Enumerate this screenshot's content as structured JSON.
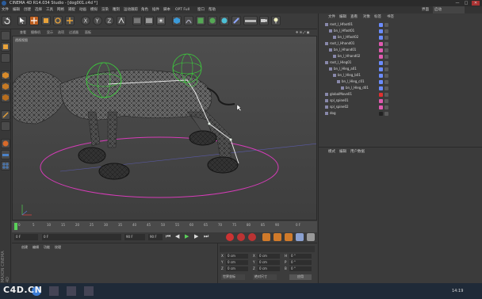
{
  "window": {
    "title": "CINEMA 4D R14.034 Studio - [dog001.c4d *]"
  },
  "window_controls": [
    "—",
    "□",
    "✕"
  ],
  "menus": [
    "文件",
    "编辑",
    "创建",
    "选择",
    "工具",
    "网格",
    "捕捉",
    "动画",
    "模拟",
    "渲染",
    "雕刻",
    "运动跟踪",
    "角色",
    "插件",
    "脚本",
    "OPT Full",
    "窗口",
    "帮助"
  ],
  "layout_label": "界面",
  "layout_value": "启动",
  "viewport": {
    "menu": [
      "查看",
      "摄像机",
      "显示",
      "选项",
      "过滤器",
      "面板"
    ],
    "label": "透视视图"
  },
  "timeline": {
    "ticks": [
      "0",
      "5",
      "10",
      "15",
      "20",
      "25",
      "30",
      "35",
      "40",
      "45",
      "50",
      "55",
      "60",
      "65",
      "70",
      "75",
      "80",
      "85",
      "90"
    ],
    "end_frame": "0 F",
    "current_frame": "0 F",
    "start_field": "0 F",
    "end_field": "90 F",
    "max_field": "90 F"
  },
  "materials_panel": {
    "menu": [
      "创建",
      "编辑",
      "功能",
      "纹理"
    ]
  },
  "coords_panel": {
    "rows": [
      {
        "a": "X",
        "a_val": "0 cm",
        "b": "X",
        "b_val": "0 cm",
        "c": "H",
        "c_val": "0 °"
      },
      {
        "a": "Y",
        "a_val": "0 cm",
        "b": "Y",
        "b_val": "0 cm",
        "c": "P",
        "c_val": "0 °"
      },
      {
        "a": "Z",
        "a_val": "0 cm",
        "b": "Z",
        "b_val": "0 cm",
        "c": "B",
        "c_val": "0 °"
      }
    ],
    "mode1": "世界坐标",
    "mode2": "绝对尺寸",
    "apply": "应用"
  },
  "object_manager": {
    "tabs": [
      "文件",
      "编辑",
      "查看",
      "对象",
      "标签",
      "书签"
    ],
    "objects": [
      {
        "indent": 0,
        "name": "root_l_Hfoot01",
        "color": "#6b8cff"
      },
      {
        "indent": 1,
        "name": "bn_l_Hfoot01",
        "color": "#6b8cff"
      },
      {
        "indent": 2,
        "name": "bn_l_Hfoot02",
        "color": "#6b8cff"
      },
      {
        "indent": 0,
        "name": "root_l_Hhand01",
        "color": "#e05ab0"
      },
      {
        "indent": 1,
        "name": "bn_l_Hhand01",
        "color": "#e05ab0"
      },
      {
        "indent": 2,
        "name": "bn_l_Hhand02",
        "color": "#e05ab0"
      },
      {
        "indent": 0,
        "name": "root_l_Hleg01",
        "color": "#6b8cff"
      },
      {
        "indent": 1,
        "name": "bn_l_Hleg_a01",
        "color": "#6b8cff"
      },
      {
        "indent": 2,
        "name": "bn_l_Hleg_b01",
        "color": "#6b8cff"
      },
      {
        "indent": 3,
        "name": "bn_l_Hleg_c01",
        "color": "#6b8cff"
      },
      {
        "indent": 4,
        "name": "bn_l_Hleg_d01",
        "color": "#6b8cff"
      },
      {
        "indent": 0,
        "name": "globalMove01",
        "color": "#e03030"
      },
      {
        "indent": 0,
        "name": "spl_spine01",
        "color": "#e05ab0"
      },
      {
        "indent": 0,
        "name": "spl_spine02",
        "color": "#e05ab0"
      },
      {
        "indent": 0,
        "name": "dog",
        "color": "#222222"
      }
    ]
  },
  "attributes_panel": {
    "tabs": [
      "模式",
      "编辑",
      "用户数据"
    ]
  },
  "logo_text": "MAXON CINEMA 4D",
  "watermark": "C4D.CN",
  "taskbar": {
    "time": "14:19"
  },
  "colors": {
    "accent": "#e8a23a",
    "selection": "#57c857",
    "ring": "#e02fb0",
    "bg": "#3a3a3a"
  }
}
